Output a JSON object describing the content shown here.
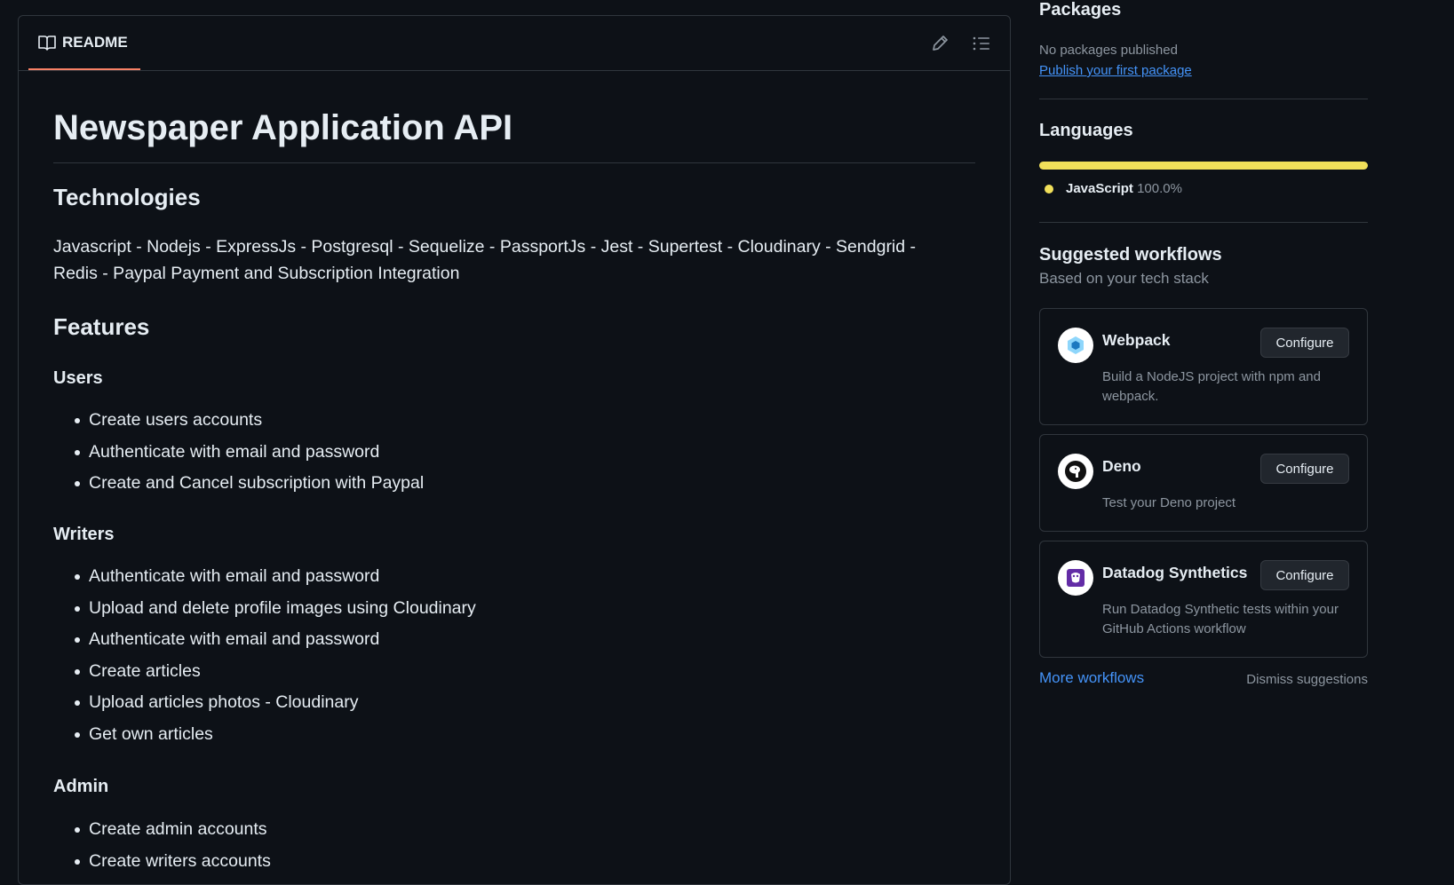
{
  "readme": {
    "tab_label": "README",
    "title": "Newspaper Application API",
    "technologies_heading": "Technologies",
    "technologies_text": "Javascript - Nodejs - ExpressJs - Postgresql - Sequelize - PassportJs - Jest - Supertest - Cloudinary - Sendgrid - Redis - Paypal Payment and Subscription Integration",
    "features_heading": "Features",
    "users_heading": "Users",
    "users_items": [
      "Create users accounts",
      "Authenticate with email and password",
      "Create and Cancel subscription with Paypal"
    ],
    "writers_heading": "Writers",
    "writers_items": [
      "Authenticate with email and password",
      "Upload and delete profile images using Cloudinary",
      "Authenticate with email and password",
      "Create articles",
      "Upload articles photos - Cloudinary",
      "Get own articles"
    ],
    "admin_heading": "Admin",
    "admin_items": [
      "Create admin accounts",
      "Create writers accounts"
    ]
  },
  "sidebar": {
    "packages": {
      "heading": "Packages",
      "empty_text": "No packages published",
      "publish_link": "Publish your first package"
    },
    "languages": {
      "heading": "Languages",
      "items": [
        {
          "name": "JavaScript",
          "percent": "100.0%",
          "color": "#f1e05a"
        }
      ]
    },
    "workflows": {
      "heading": "Suggested workflows",
      "subheading": "Based on your tech stack",
      "cards": [
        {
          "name": "Webpack",
          "description": "Build a NodeJS project with npm and webpack.",
          "button": "Configure",
          "icon": "webpack-icon"
        },
        {
          "name": "Deno",
          "description": "Test your Deno project",
          "button": "Configure",
          "icon": "deno-icon"
        },
        {
          "name": "Datadog Synthetics",
          "description": "Run Datadog Synthetic tests within your GitHub Actions workflow",
          "button": "Configure",
          "icon": "datadog-icon"
        }
      ],
      "more_link": "More workflows",
      "dismiss": "Dismiss suggestions"
    }
  },
  "colors": {
    "background": "#0d1117",
    "border": "#30363d",
    "tab_underline": "#f78166",
    "link": "#4493f8",
    "javascript": "#f1e05a"
  }
}
